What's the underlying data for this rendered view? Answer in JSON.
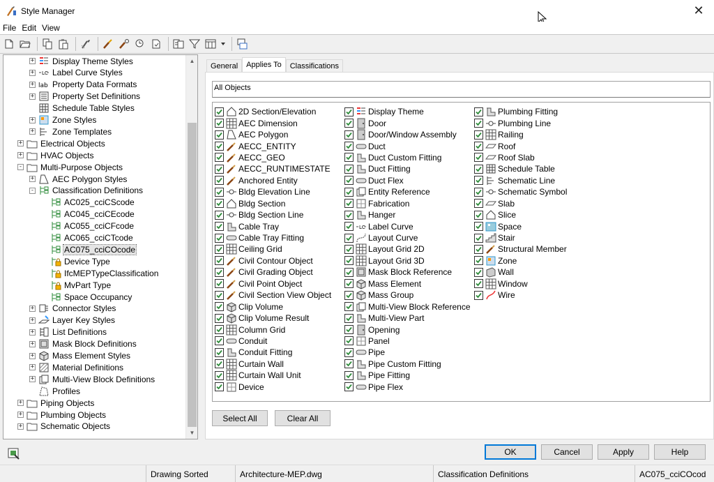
{
  "window": {
    "title": "Style Manager"
  },
  "menu": [
    "File",
    "Edit",
    "View"
  ],
  "toolbar": {
    "icons": [
      "new-drawing-icon",
      "open-drawing-icon",
      "copy-icon",
      "paste-icon",
      "purge-icon",
      "edit-style-icon",
      "set-from-icon",
      "inventory-icon",
      "toggle-view-icon",
      "filter-icon",
      "view-mode-icon",
      "dropdown-icon",
      "sort-icon"
    ]
  },
  "tree": {
    "items": [
      {
        "label": "Display Theme Styles",
        "level": 2,
        "exp": "+",
        "icon": "display-theme-icon"
      },
      {
        "label": "Label Curve Styles",
        "level": 2,
        "exp": "+",
        "icon": "label-curve-icon"
      },
      {
        "label": "Property Data Formats",
        "level": 2,
        "exp": "+",
        "icon": "property-format-icon"
      },
      {
        "label": "Property Set Definitions",
        "level": 2,
        "exp": "+",
        "icon": "property-set-icon"
      },
      {
        "label": "Schedule Table Styles",
        "level": 2,
        "exp": "",
        "icon": "schedule-table-icon"
      },
      {
        "label": "Zone Styles",
        "level": 2,
        "exp": "+",
        "icon": "zone-icon"
      },
      {
        "label": "Zone Templates",
        "level": 2,
        "exp": "+",
        "icon": "zone-template-icon"
      },
      {
        "label": "Electrical Objects",
        "level": 1,
        "exp": "+",
        "icon": "folder-icon"
      },
      {
        "label": "HVAC Objects",
        "level": 1,
        "exp": "+",
        "icon": "folder-icon"
      },
      {
        "label": "Multi-Purpose Objects",
        "level": 1,
        "exp": "-",
        "icon": "folder-icon"
      },
      {
        "label": "AEC Polygon Styles",
        "level": 2,
        "exp": "+",
        "icon": "aec-polygon-icon"
      },
      {
        "label": "Classification Definitions",
        "level": 2,
        "exp": "-",
        "icon": "classification-icon"
      },
      {
        "label": "AC025_cciCScode",
        "level": 3,
        "exp": "",
        "icon": "classification-item-icon"
      },
      {
        "label": "AC045_cciCEcode",
        "level": 3,
        "exp": "",
        "icon": "classification-item-icon"
      },
      {
        "label": "AC055_cciCFcode",
        "level": 3,
        "exp": "",
        "icon": "classification-item-icon"
      },
      {
        "label": "AC065_cciCTcode",
        "level": 3,
        "exp": "",
        "icon": "classification-item-icon"
      },
      {
        "label": "AC075_cciCOcode",
        "level": 3,
        "exp": "",
        "icon": "classification-item-icon",
        "selected": true
      },
      {
        "label": "Device Type",
        "level": 3,
        "exp": "",
        "icon": "classification-locked-icon"
      },
      {
        "label": "IfcMEPTypeClassification",
        "level": 3,
        "exp": "",
        "icon": "classification-locked-icon"
      },
      {
        "label": "MvPart Type",
        "level": 3,
        "exp": "",
        "icon": "classification-locked-icon"
      },
      {
        "label": "Space Occupancy",
        "level": 3,
        "exp": "",
        "icon": "classification-item-icon"
      },
      {
        "label": "Connector Styles",
        "level": 2,
        "exp": "+",
        "icon": "connector-icon"
      },
      {
        "label": "Layer Key Styles",
        "level": 2,
        "exp": "+",
        "icon": "layer-key-icon"
      },
      {
        "label": "List Definitions",
        "level": 2,
        "exp": "+",
        "icon": "list-definition-icon"
      },
      {
        "label": "Mask Block Definitions",
        "level": 2,
        "exp": "+",
        "icon": "mask-block-icon"
      },
      {
        "label": "Mass Element Styles",
        "level": 2,
        "exp": "+",
        "icon": "mass-element-icon"
      },
      {
        "label": "Material Definitions",
        "level": 2,
        "exp": "+",
        "icon": "material-icon"
      },
      {
        "label": "Multi-View Block Definitions",
        "level": 2,
        "exp": "+",
        "icon": "mvblock-icon"
      },
      {
        "label": "Profiles",
        "level": 2,
        "exp": "",
        "icon": "profile-icon"
      },
      {
        "label": "Piping Objects",
        "level": 1,
        "exp": "+",
        "icon": "folder-icon"
      },
      {
        "label": "Plumbing Objects",
        "level": 1,
        "exp": "+",
        "icon": "folder-icon"
      },
      {
        "label": "Schematic Objects",
        "level": 1,
        "exp": "+",
        "icon": "folder-icon"
      }
    ]
  },
  "tabs": [
    {
      "label": "General",
      "active": false
    },
    {
      "label": "Applies To",
      "active": true
    },
    {
      "label": "Classifications",
      "active": false
    }
  ],
  "applies_to": {
    "summary": "All Objects",
    "columns": [
      [
        "2D Section/Elevation",
        "AEC Dimension",
        "AEC Polygon",
        "AECC_ENTITY",
        "AECC_GEO",
        "AECC_RUNTIMESTATE",
        "Anchored Entity",
        "Bldg Elevation Line",
        "Bldg Section",
        "Bldg Section Line",
        "Cable Tray",
        "Cable Tray Fitting",
        "Ceiling Grid",
        "Civil Contour Object",
        "Civil Grading Object",
        "Civil Point Object",
        "Civil Section View Object",
        "Clip Volume",
        "Clip Volume Result",
        "Column Grid",
        "Conduit",
        "Conduit Fitting",
        "Curtain Wall",
        "Curtain Wall Unit",
        "Device"
      ],
      [
        "Display Theme",
        "Door",
        "Door/Window Assembly",
        "Duct",
        "Duct Custom Fitting",
        "Duct Fitting",
        "Duct Flex",
        "Entity Reference",
        "Fabrication",
        "Hanger",
        "Label Curve",
        "Layout Curve",
        "Layout Grid 2D",
        "Layout Grid 3D",
        "Mask Block Reference",
        "Mass Element",
        "Mass Group",
        "Multi-View Block Reference",
        "Multi-View Part",
        "Opening",
        "Panel",
        "Pipe",
        "Pipe Custom Fitting",
        "Pipe Fitting",
        "Pipe Flex"
      ],
      [
        "Plumbing Fitting",
        "Plumbing Line",
        "Railing",
        "Roof",
        "Roof Slab",
        "Schedule Table",
        "Schematic Line",
        "Schematic Symbol",
        "Slab",
        "Slice",
        "Space",
        "Stair",
        "Structural Member",
        "Zone",
        "Wall",
        "Window",
        "Wire"
      ]
    ],
    "select_all": "Select All",
    "clear_all": "Clear All"
  },
  "buttons": {
    "ok": "OK",
    "cancel": "Cancel",
    "apply": "Apply",
    "help": "Help"
  },
  "status": {
    "sort": "Drawing Sorted",
    "drawing": "Architecture-MEP.dwg",
    "category": "Classification Definitions",
    "style": "AC075_cciCOcod"
  },
  "colors": {
    "accent": "#0078d7",
    "check": "#2e8b3a",
    "brush": "#8b4513"
  }
}
